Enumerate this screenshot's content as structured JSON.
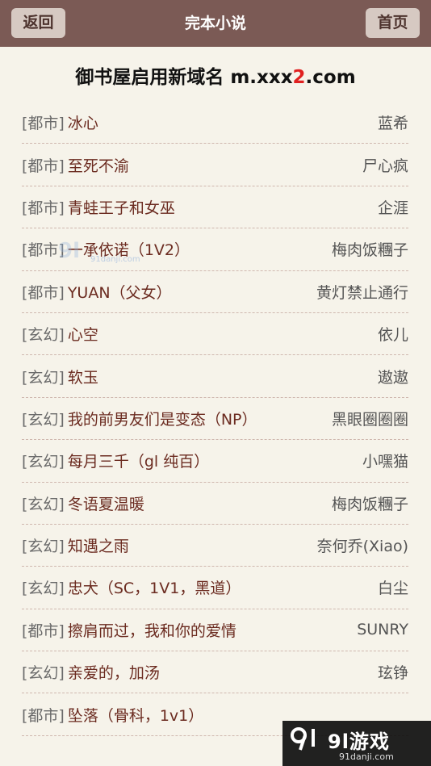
{
  "header": {
    "back_label": "返回",
    "title": "完本小说",
    "home_label": "首页"
  },
  "notice": {
    "prefix": "御书屋启用新域名 m.xxx",
    "highlight": "2",
    "suffix": ".com"
  },
  "books": [
    {
      "category": "[都市]",
      "title": "冰心",
      "author": "蓝希"
    },
    {
      "category": "[都市]",
      "title": "至死不渝",
      "author": "尸心疯"
    },
    {
      "category": "[都市]",
      "title": "青蛙王子和女巫",
      "author": "企涯"
    },
    {
      "category": "[都市]",
      "title": "一承依诺（1V2）",
      "author": "梅肉饭糰子"
    },
    {
      "category": "[都市]",
      "title": "YUAN（父女）",
      "author": "黄灯禁止通行"
    },
    {
      "category": "[玄幻]",
      "title": "心空",
      "author": "依儿"
    },
    {
      "category": "[玄幻]",
      "title": "软玉",
      "author": "遨遨"
    },
    {
      "category": "[玄幻]",
      "title": "我的前男友们是变态（NP）",
      "author": "黑眼圈圈圈"
    },
    {
      "category": "[玄幻]",
      "title": "每月三千（gl 纯百）",
      "author": "小嘿猫"
    },
    {
      "category": "[玄幻]",
      "title": "冬语夏温暖",
      "author": "梅肉饭糰子"
    },
    {
      "category": "[玄幻]",
      "title": "知遇之雨",
      "author": "奈何乔(Xiao)"
    },
    {
      "category": "[玄幻]",
      "title": "忠犬（SC，1V1，黑道）",
      "author": "白尘"
    },
    {
      "category": "[都市]",
      "title": "擦肩而过，我和你的爱情",
      "author": "SUNRY"
    },
    {
      "category": "[玄幻]",
      "title": "亲爱的，加汤",
      "author": "玹铮"
    },
    {
      "category": "[都市]",
      "title": "坠落（骨科，1v1）",
      "author": ""
    }
  ],
  "watermark_center": {
    "mark": "9l",
    "url": "91danji.com"
  },
  "watermark_corner": {
    "brand": "9l游戏",
    "url": "91danji.com"
  }
}
